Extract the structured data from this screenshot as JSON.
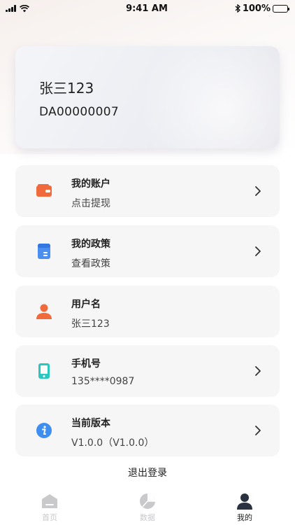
{
  "status_bar": {
    "time": "9:41 AM",
    "battery": "100%"
  },
  "profile": {
    "name": "张三123",
    "id": "DA00000007"
  },
  "menu": [
    {
      "title": "我的账户",
      "subtitle": "点击提现",
      "icon": "wallet-icon",
      "has_chevron": true
    },
    {
      "title": "我的政策",
      "subtitle": "查看政策",
      "icon": "policy-book-icon",
      "has_chevron": true
    },
    {
      "title": "用户名",
      "subtitle": "张三123",
      "icon": "user-icon",
      "has_chevron": false
    },
    {
      "title": "手机号",
      "subtitle": "135****0987",
      "icon": "phone-icon",
      "has_chevron": true
    },
    {
      "title": "当前版本",
      "subtitle": "V1.0.0（V1.0.0）",
      "icon": "info-icon",
      "has_chevron": true
    }
  ],
  "logout_label": "退出登录",
  "tabs": [
    {
      "label": "首页",
      "icon": "home-icon",
      "active": false
    },
    {
      "label": "数据",
      "icon": "pie-chart-icon",
      "active": false
    },
    {
      "label": "我的",
      "icon": "profile-icon",
      "active": true
    }
  ],
  "colors": {
    "wallet": "#f06a3c",
    "policy": "#4a8ff0",
    "user": "#f06a3c",
    "phone": "#2cc7c0",
    "info": "#3d8ef0",
    "tab_inactive": "#c9c9cc",
    "tab_active": "#2a3140"
  }
}
